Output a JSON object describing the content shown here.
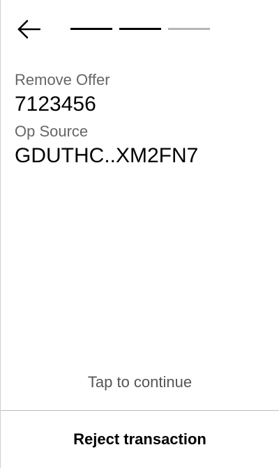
{
  "header": {
    "back_icon": "arrow-left-icon",
    "progress": {
      "total_steps": 3,
      "completed_steps": 2,
      "active_color": "#000000",
      "pending_color": "#b5b5b5"
    }
  },
  "details": {
    "operation_label": "Remove Offer",
    "operation_value": "7123456",
    "source_label": "Op Source",
    "source_value": "GDUTHC..XM2FN7"
  },
  "footer": {
    "tap_hint": "Tap to continue",
    "reject_label": "Reject transaction"
  }
}
